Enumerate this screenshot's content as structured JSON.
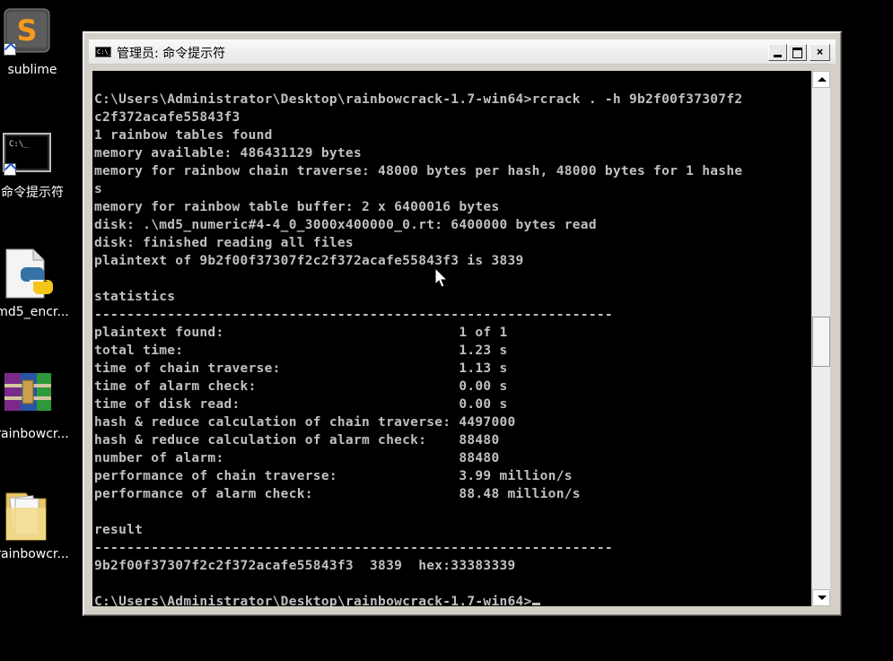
{
  "desktop": {
    "icons": [
      {
        "label": "sublime",
        "icon": "sublime-text-icon"
      },
      {
        "label": "命令提示符",
        "icon": "command-prompt-icon"
      },
      {
        "label": "md5_encr...",
        "icon": "python-file-icon"
      },
      {
        "label": "rainbowcr...",
        "icon": "winrar-archive-icon"
      },
      {
        "label": "rainbowcr...",
        "icon": "folder-icon"
      }
    ]
  },
  "window": {
    "title": "管理员: 命令提示符",
    "icon_text": "C:\\_",
    "buttons": {
      "minimize": "minimize-icon",
      "maximize": "maximize-icon",
      "close": "×"
    }
  },
  "console": {
    "lines": [
      "",
      "C:\\Users\\Administrator\\Desktop\\rainbowcrack-1.7-win64>rcrack . -h 9b2f00f37307f2",
      "c2f372acafe55843f3",
      "1 rainbow tables found",
      "memory available: 486431129 bytes",
      "memory for rainbow chain traverse: 48000 bytes per hash, 48000 bytes for 1 hashe",
      "s",
      "memory for rainbow table buffer: 2 x 6400016 bytes",
      "disk: .\\md5_numeric#4-4_0_3000x400000_0.rt: 6400000 bytes read",
      "disk: finished reading all files",
      "plaintext of 9b2f00f37307f2c2f372acafe55843f3 is 3839",
      "",
      "statistics",
      "----------------------------------------------------------------",
      "plaintext found:                             1 of 1",
      "total time:                                  1.23 s",
      "time of chain traverse:                      1.13 s",
      "time of alarm check:                         0.00 s",
      "time of disk read:                           0.00 s",
      "hash & reduce calculation of chain traverse: 4497000",
      "hash & reduce calculation of alarm check:    88480",
      "number of alarm:                             88480",
      "performance of chain traverse:               3.99 million/s",
      "performance of alarm check:                  88.48 million/s",
      "",
      "result",
      "----------------------------------------------------------------",
      "9b2f00f37307f2c2f372acafe55843f3  3839  hex:33383339",
      "",
      "C:\\Users\\Administrator\\Desktop\\rainbowcrack-1.7-win64>"
    ],
    "text_color": "#c0c0c0",
    "background": "#000000"
  },
  "scrollbar": {
    "up": "scroll-up-arrow-icon",
    "down": "scroll-down-arrow-icon"
  }
}
